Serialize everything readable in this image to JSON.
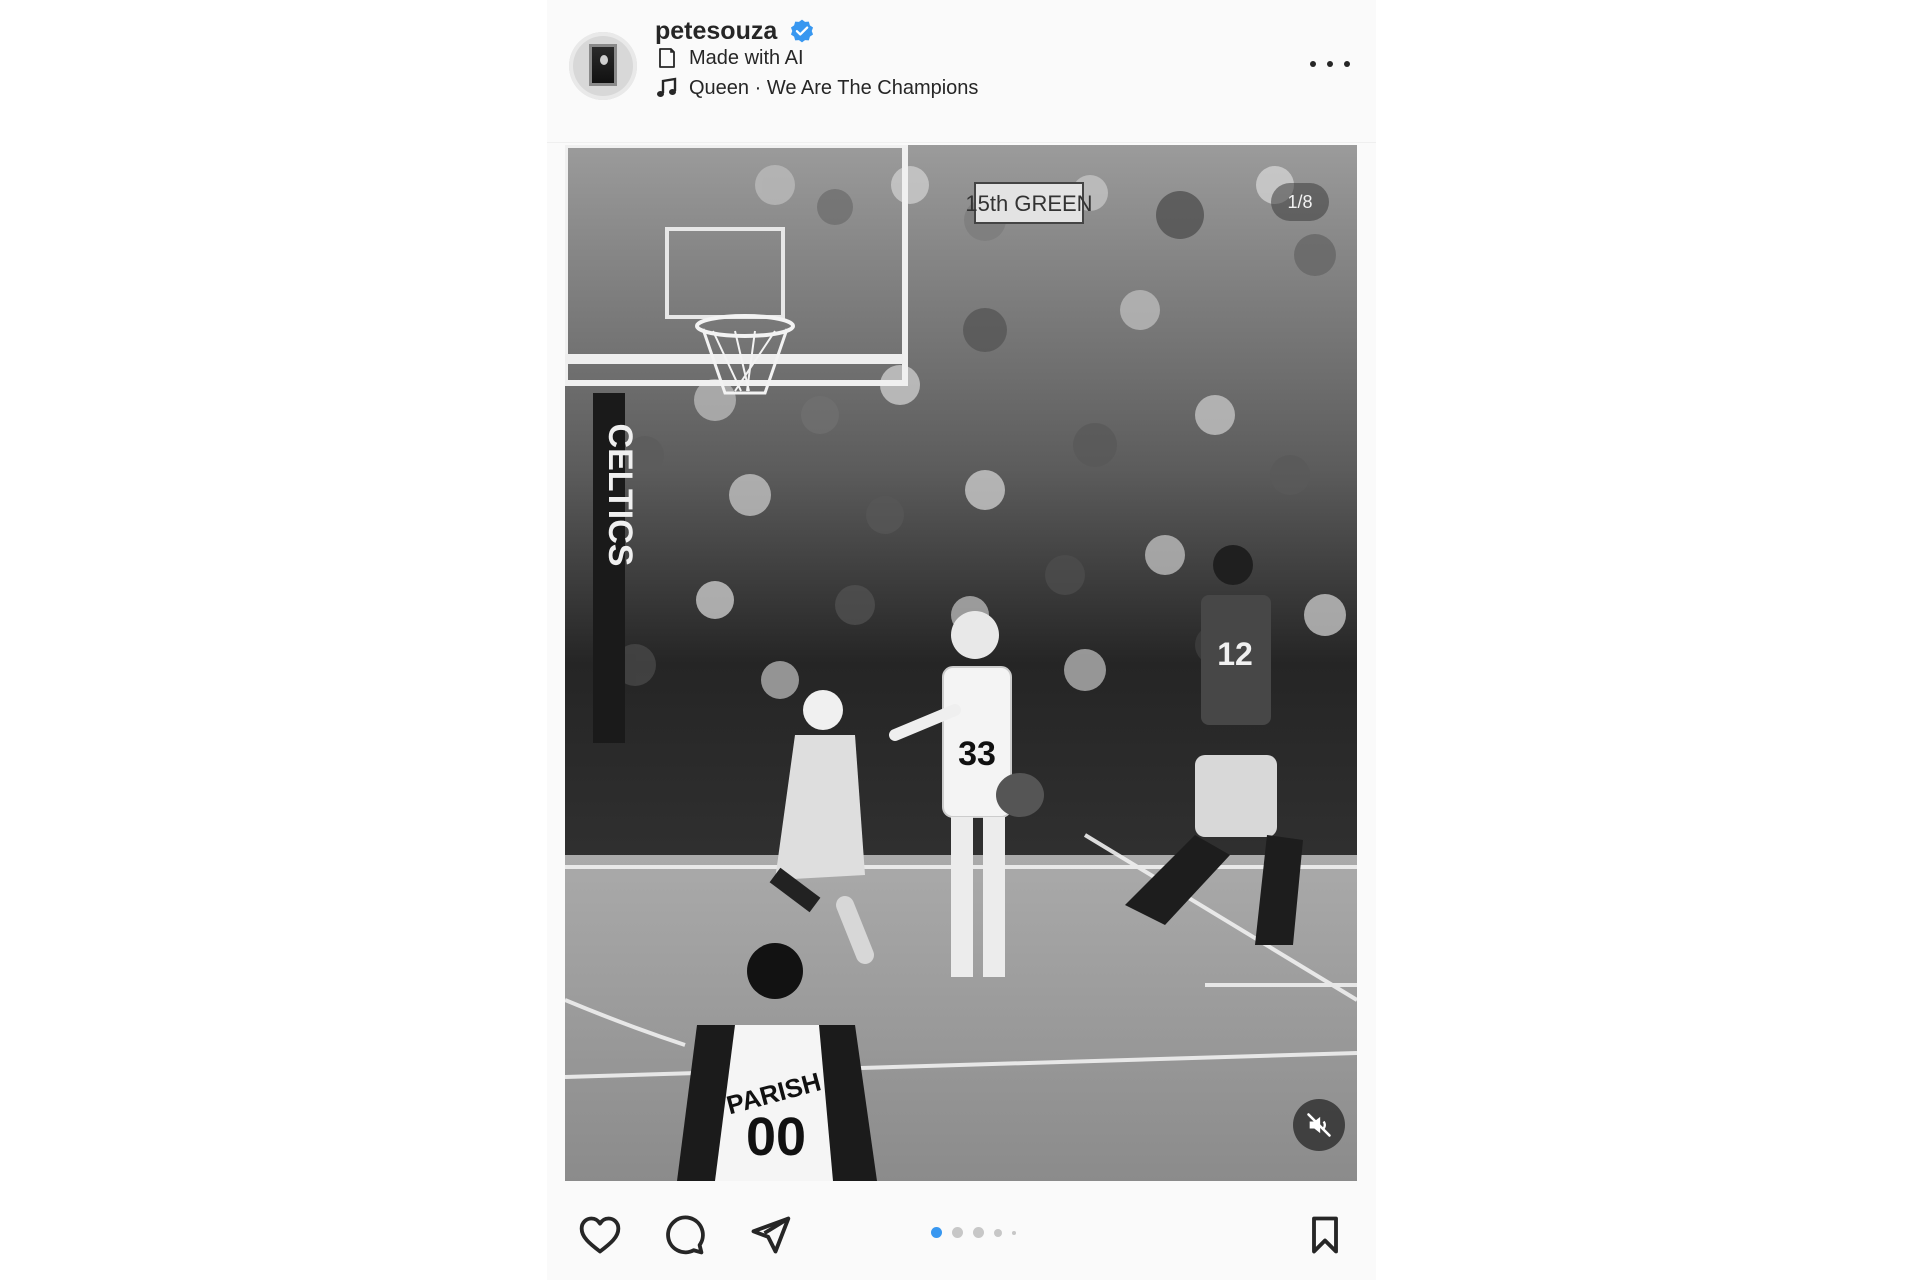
{
  "post": {
    "username": "petesouza",
    "verified": true,
    "ai_label": "Made with AI",
    "music": "Queen · We Are The Champions",
    "media": {
      "page_indicator": "1/8",
      "current_slide": 1,
      "total_slides": 8,
      "type": "black-and-white basketball photo",
      "arena_sign": "15th GREEN",
      "court_text": "CELTICS",
      "jersey_numbers": [
        "33",
        "12",
        "00"
      ],
      "jersey_name": "PARISH"
    },
    "carousel": {
      "active_index": 0,
      "visible_dots": 5
    }
  },
  "icons": {
    "verified": "verified-badge-icon",
    "ai": "ai-label-icon",
    "music": "music-note-icon",
    "more": "more-options-icon",
    "mute": "mute-icon",
    "like": "heart-icon",
    "comment": "comment-icon",
    "share": "send-icon",
    "save": "bookmark-icon"
  },
  "colors": {
    "verified": "#3897f0",
    "text": "#262626",
    "active_dot": "#3897f0",
    "inactive_dot": "#c7c7c7"
  }
}
